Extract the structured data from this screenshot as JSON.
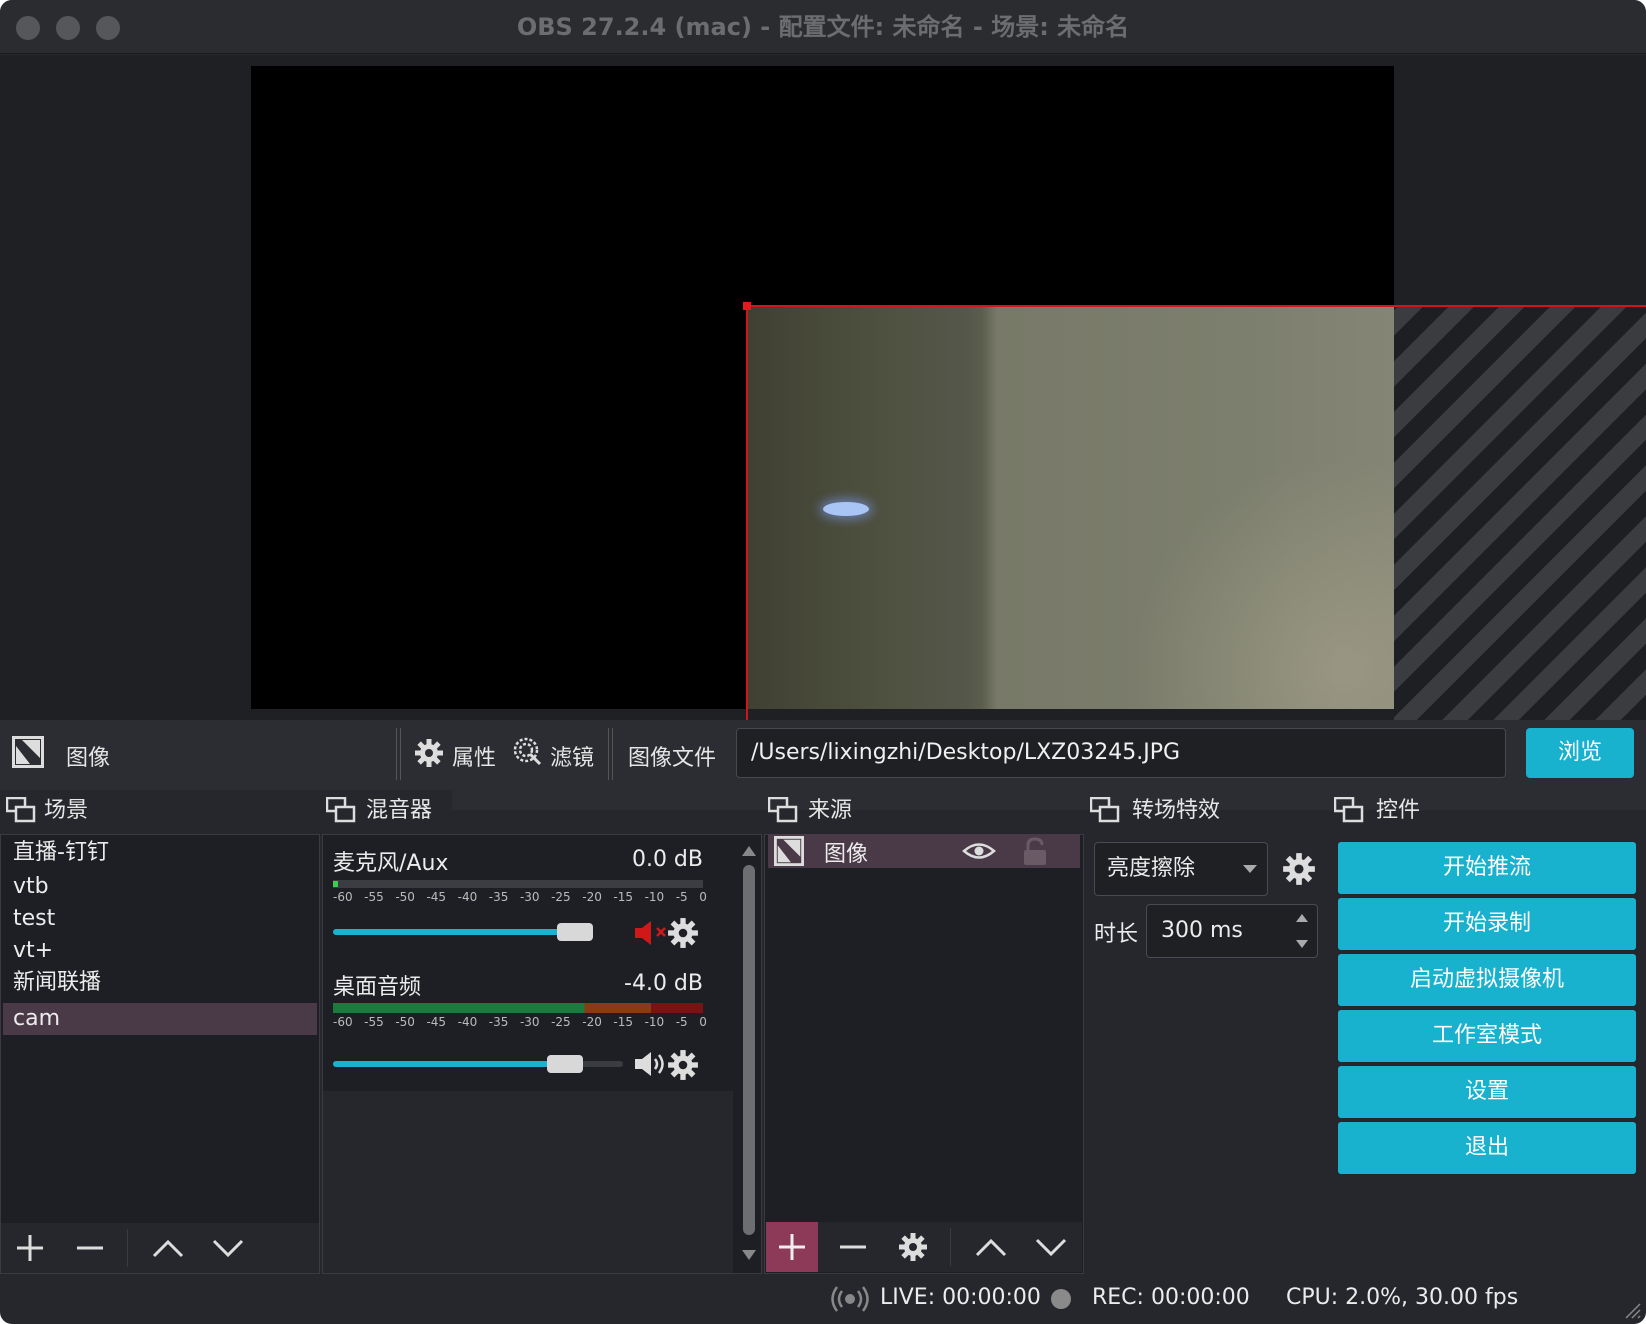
{
  "window": {
    "title": "OBS 27.2.4 (mac) - 配置文件: 未命名 - 场景: 未命名"
  },
  "source_toolbar": {
    "source_label": "图像",
    "properties_label": "属性",
    "filters_label": "滤镜",
    "image_file_label": "图像文件",
    "image_path": "/Users/lixingzhi/Desktop/LXZ03245.JPG",
    "browse_label": "浏览"
  },
  "scenes": {
    "header": "场景",
    "items": [
      "直播-钉钉",
      "vtb",
      "test",
      "vt+",
      "新闻联播",
      "cam"
    ],
    "selected": "cam"
  },
  "mixer": {
    "header": "混音器",
    "tick_labels": [
      "-60",
      "-55",
      "-50",
      "-45",
      "-40",
      "-35",
      "-30",
      "-25",
      "-20",
      "-15",
      "-10",
      "-5",
      "0"
    ],
    "channels": [
      {
        "name": "麦克风/Aux",
        "db": "0.0 dB",
        "volume": 0.93,
        "muted": true
      },
      {
        "name": "桌面音频",
        "db": "-4.0 dB",
        "volume": 0.8,
        "muted": false
      }
    ]
  },
  "sources": {
    "header": "来源",
    "items": [
      {
        "name": "图像",
        "visible": true,
        "locked": false
      }
    ]
  },
  "transitions": {
    "header": "转场特效",
    "selected": "亮度擦除",
    "duration_label": "时长",
    "duration_value": "300 ms"
  },
  "controls": {
    "header": "控件",
    "buttons": [
      "开始推流",
      "开始录制",
      "启动虚拟摄像机",
      "工作室模式",
      "设置",
      "退出"
    ]
  },
  "status_bar": {
    "live": "LIVE: 00:00:00",
    "rec": "REC: 00:00:00",
    "cpu": "CPU: 2.0%, 30.00 fps"
  },
  "colors": {
    "accent": "#18b2cf",
    "selection": "#d0161b",
    "selected_row": "#4a3a47",
    "panel_bg": "#1e1f24",
    "window_bg": "#25272c"
  }
}
